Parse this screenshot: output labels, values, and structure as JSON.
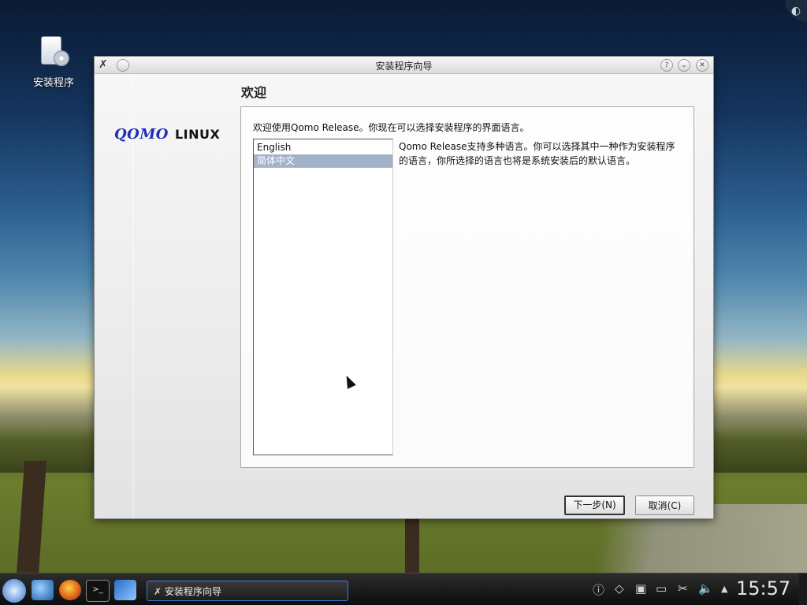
{
  "desktop": {
    "icons": [
      {
        "label": "安装程序",
        "icon": "installer-icon"
      }
    ]
  },
  "window": {
    "title": "安装程序向导",
    "controls": {
      "help": "?",
      "minimize": "⌄",
      "close": "✕"
    },
    "logo": {
      "brand": "QOMO",
      "suffix": "LINUX"
    },
    "heading": "欢迎",
    "intro": "欢迎使用Qomo Release。你现在可以选择安装程序的界面语言。",
    "languages": [
      {
        "label": "English",
        "selected": false
      },
      {
        "label": "简体中文",
        "selected": true
      }
    ],
    "description": "Qomo Release支持多种语言。你可以选择其中一种作为安装程序的语言，你所选择的语言也将是系统安装后的默认语言。",
    "buttons": {
      "next": "下一步(N)",
      "cancel": "取消(C)"
    }
  },
  "taskbar": {
    "active_task": "安装程序向导",
    "clock": "15:57",
    "tray_icons": [
      "info-icon",
      "network-manager-icon",
      "display-icon",
      "storage-icon",
      "scissors-icon",
      "volume-icon",
      "tray-arrow-icon"
    ]
  },
  "colors": {
    "selection": "#a2b3c9",
    "task_border": "#3b7ad6",
    "logo_blue": "#1d2fb8"
  }
}
